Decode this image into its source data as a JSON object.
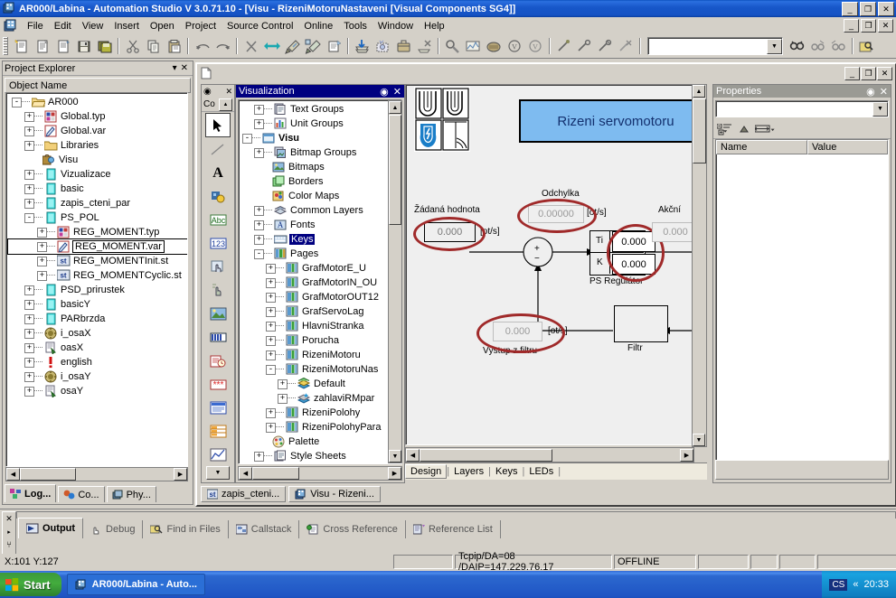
{
  "window": {
    "title": "AR000/Labina - Automation Studio V 3.0.71.10 - [Visu - RizeniMotoruNastaveni [Visual Components SG4]]",
    "minimize": "_",
    "maximize": "❐",
    "close": "✕",
    "icon": "automation-studio-icon"
  },
  "menu": {
    "items": [
      "File",
      "Edit",
      "View",
      "Insert",
      "Open",
      "Project",
      "Source Control",
      "Online",
      "Tools",
      "Window",
      "Help"
    ],
    "doc_icon": "document-icon"
  },
  "toolbar": {
    "combo_value": "",
    "groups": [
      {
        "name": "file",
        "buttons": [
          "new-project-icon",
          "open-project-icon",
          "save-as-icon",
          "save-icon",
          "save-all-icon"
        ]
      },
      {
        "name": "edit",
        "buttons": [
          "cut-icon",
          "copy-icon",
          "paste-icon"
        ]
      },
      {
        "name": "history",
        "buttons": [
          "undo-icon",
          "redo-icon"
        ]
      },
      {
        "name": "build",
        "buttons": [
          "stop-icon",
          "transfer-icon",
          "build-icon",
          "build-all-icon",
          "build-config-icon"
        ]
      },
      {
        "name": "download",
        "buttons": [
          "download-icon",
          "download-changes-icon",
          "project-install-icon",
          "remove-icon"
        ]
      },
      {
        "name": "monitor",
        "buttons": [
          "watch-icon",
          "trace-icon",
          "profiler-icon",
          "monitor-icon",
          "monitor-off-icon"
        ]
      },
      {
        "name": "debug",
        "buttons": [
          "breakpoint-icon",
          "step-icon",
          "step-over-icon",
          "clear-breakpoints-icon"
        ]
      },
      {
        "name": "find",
        "buttons": [
          "find-icon",
          "find-next-icon",
          "find-prev-icon",
          "find-in-files-icon"
        ]
      }
    ]
  },
  "project_explorer": {
    "title": "Project Explorer",
    "column_header": "Object Name",
    "auto_hide": "▾",
    "close": "✕",
    "tree": [
      {
        "label": "AR000",
        "depth": 0,
        "expander": "-",
        "icon": "folder-open-icon",
        "selected": false
      },
      {
        "label": "Global.typ",
        "depth": 1,
        "expander": "+",
        "icon": "typ-file-icon",
        "selected": false
      },
      {
        "label": "Global.var",
        "depth": 1,
        "expander": "+",
        "icon": "var-file-icon",
        "selected": false
      },
      {
        "label": "Libraries",
        "depth": 1,
        "expander": "+",
        "icon": "folder-icon",
        "selected": false
      },
      {
        "label": "Visu",
        "depth": 1,
        "expander": "",
        "icon": "visu-icon",
        "selected": false
      },
      {
        "label": "Vizualizace",
        "depth": 1,
        "expander": "+",
        "icon": "package-icon",
        "selected": false
      },
      {
        "label": "basic",
        "depth": 1,
        "expander": "+",
        "icon": "package-icon",
        "selected": false
      },
      {
        "label": "zapis_cteni_par",
        "depth": 1,
        "expander": "+",
        "icon": "package-icon",
        "selected": false
      },
      {
        "label": "PS_POL",
        "depth": 1,
        "expander": "-",
        "icon": "package-icon",
        "selected": false
      },
      {
        "label": "REG_MOMENT.typ",
        "depth": 2,
        "expander": "+",
        "icon": "typ-file-icon",
        "selected": false
      },
      {
        "label": "REG_MOMENT.var",
        "depth": 2,
        "expander": "+",
        "icon": "var-file-icon",
        "selected": true
      },
      {
        "label": "REG_MOMENTInit.st",
        "depth": 2,
        "expander": "+",
        "icon": "st-file-icon",
        "selected": false
      },
      {
        "label": "REG_MOMENTCyclic.st",
        "depth": 2,
        "expander": "+",
        "icon": "st-file-icon",
        "selected": false
      },
      {
        "label": "PSD_prirustek",
        "depth": 1,
        "expander": "+",
        "icon": "package-icon",
        "selected": false
      },
      {
        "label": "basicY",
        "depth": 1,
        "expander": "+",
        "icon": "package-icon",
        "selected": false
      },
      {
        "label": "PARbrzda",
        "depth": 1,
        "expander": "+",
        "icon": "package-icon",
        "selected": false
      },
      {
        "label": "i_osaX",
        "depth": 1,
        "expander": "+",
        "icon": "axis-icon",
        "selected": false
      },
      {
        "label": "oasX",
        "depth": 1,
        "expander": "+",
        "icon": "config-icon",
        "selected": false
      },
      {
        "label": "english",
        "depth": 1,
        "expander": "+",
        "icon": "alarm-icon",
        "selected": false
      },
      {
        "label": "i_osaY",
        "depth": 1,
        "expander": "+",
        "icon": "axis-icon",
        "selected": false
      },
      {
        "label": "osaY",
        "depth": 1,
        "expander": "+",
        "icon": "config-icon",
        "selected": false
      }
    ],
    "tabs": [
      {
        "label": "Log...",
        "icon": "logical-view-icon",
        "active": true
      },
      {
        "label": "Co...",
        "icon": "configuration-view-icon",
        "active": false
      },
      {
        "label": "Phy...",
        "icon": "physical-view-icon",
        "active": false
      }
    ]
  },
  "toolbox": {
    "header": "Co",
    "scroll_up": "▲",
    "scroll_down": "▼",
    "tools": [
      {
        "name": "pointer-tool",
        "selected": true
      },
      {
        "name": "line-tool",
        "selected": false
      },
      {
        "name": "text-tool",
        "selected": false
      },
      {
        "name": "bitmap-button-tool",
        "selected": false
      },
      {
        "name": "string-output-tool",
        "selected": false
      },
      {
        "name": "numeric-output-tool",
        "selected": false,
        "highlighted": true
      },
      {
        "name": "touch-area-tool",
        "selected": false,
        "highlighted": true
      },
      {
        "name": "hotspot-tool",
        "selected": false
      },
      {
        "name": "picture-tool",
        "selected": false
      },
      {
        "name": "bargraph-tool",
        "selected": false
      },
      {
        "name": "datetime-tool",
        "selected": false
      },
      {
        "name": "password-tool",
        "selected": false
      },
      {
        "name": "listbox-tool",
        "selected": false
      },
      {
        "name": "table-tool",
        "selected": false
      },
      {
        "name": "trend-tool",
        "selected": false
      }
    ]
  },
  "visualization_panel": {
    "title": "Visualization",
    "pin": "◉",
    "close": "✕",
    "tree": [
      {
        "label": "Text Groups",
        "depth": 1,
        "expander": "+",
        "icon": "text-groups-icon",
        "bold": false,
        "selected": false
      },
      {
        "label": "Unit Groups",
        "depth": 1,
        "expander": "+",
        "icon": "unit-groups-icon",
        "bold": false,
        "selected": false
      },
      {
        "label": "Visu",
        "depth": 0,
        "expander": "-",
        "icon": "visu-root-icon",
        "bold": true,
        "selected": false
      },
      {
        "label": "Bitmap Groups",
        "depth": 1,
        "expander": "+",
        "icon": "bitmap-groups-icon",
        "bold": false,
        "selected": false
      },
      {
        "label": "Bitmaps",
        "depth": 1,
        "expander": "",
        "icon": "bitmaps-icon",
        "bold": false,
        "selected": false
      },
      {
        "label": "Borders",
        "depth": 1,
        "expander": "",
        "icon": "borders-icon",
        "bold": false,
        "selected": false
      },
      {
        "label": "Color Maps",
        "depth": 1,
        "expander": "",
        "icon": "color-maps-icon",
        "bold": false,
        "selected": false
      },
      {
        "label": "Common Layers",
        "depth": 1,
        "expander": "+",
        "icon": "layers-icon",
        "bold": false,
        "selected": false
      },
      {
        "label": "Fonts",
        "depth": 1,
        "expander": "+",
        "icon": "fonts-icon",
        "bold": false,
        "selected": false
      },
      {
        "label": "Keys",
        "depth": 1,
        "expander": "+",
        "icon": "keys-icon",
        "bold": false,
        "selected": true
      },
      {
        "label": "Pages",
        "depth": 1,
        "expander": "-",
        "icon": "pages-icon",
        "bold": false,
        "selected": false
      },
      {
        "label": "GrafMotorE_U",
        "depth": 2,
        "expander": "+",
        "icon": "page-icon",
        "bold": false,
        "selected": false
      },
      {
        "label": "GrafMotorIN_OU",
        "depth": 2,
        "expander": "+",
        "icon": "page-icon",
        "bold": false,
        "selected": false
      },
      {
        "label": "GrafMotorOUT12",
        "depth": 2,
        "expander": "+",
        "icon": "page-icon",
        "bold": false,
        "selected": false
      },
      {
        "label": "GrafServoLag",
        "depth": 2,
        "expander": "+",
        "icon": "page-icon",
        "bold": false,
        "selected": false
      },
      {
        "label": "HlavniStranka",
        "depth": 2,
        "expander": "+",
        "icon": "page-icon",
        "bold": false,
        "selected": false
      },
      {
        "label": "Porucha",
        "depth": 2,
        "expander": "+",
        "icon": "page-icon",
        "bold": false,
        "selected": false
      },
      {
        "label": "RizeniMotoru",
        "depth": 2,
        "expander": "+",
        "icon": "page-icon",
        "bold": false,
        "selected": false
      },
      {
        "label": "RizeniMotoruNas",
        "depth": 2,
        "expander": "-",
        "icon": "page-icon",
        "bold": false,
        "selected": false
      },
      {
        "label": "Default",
        "depth": 3,
        "expander": "+",
        "icon": "layer-icon",
        "bold": false,
        "selected": false
      },
      {
        "label": "zahlaviRMpar",
        "depth": 3,
        "expander": "+",
        "icon": "layer-star-icon",
        "bold": false,
        "selected": false
      },
      {
        "label": "RizeniPolohy",
        "depth": 2,
        "expander": "+",
        "icon": "page-icon",
        "bold": false,
        "selected": false
      },
      {
        "label": "RizeniPolohyPara",
        "depth": 2,
        "expander": "+",
        "icon": "page-icon",
        "bold": false,
        "selected": false
      },
      {
        "label": "Palette",
        "depth": 1,
        "expander": "",
        "icon": "palette-icon",
        "bold": false,
        "selected": false
      },
      {
        "label": "Style Sheets",
        "depth": 1,
        "expander": "+",
        "icon": "stylesheets-icon",
        "bold": false,
        "selected": false
      }
    ]
  },
  "canvas": {
    "banner_title": "Rizeni servomotoru",
    "logo": "vut-fekt-logo",
    "labels": {
      "setpoint": "Žádaná hodnota",
      "setpoint_unit": "[ot/s]",
      "deviation": "Odchylka",
      "deviation_unit": "[ot/s]",
      "action": "Akční",
      "regulator": "PS Regulátor",
      "regulator_ti": "Ti",
      "regulator_k": "K",
      "filter": "Filtr",
      "filter_out": "Výstup z filtru",
      "filter_out_unit": "[ot/s]",
      "sum_plus": "+",
      "sum_minus": "−"
    },
    "values": {
      "setpoint": "0.000",
      "deviation": "0.00000",
      "regulator_ti": "0.000",
      "regulator_k": "0.000",
      "action": "0.000",
      "filter_out": "0.000"
    },
    "annotation_color": "#a02a2a",
    "tabs": [
      {
        "label": "Design",
        "active": true
      },
      {
        "label": "Layers",
        "active": false
      },
      {
        "label": "Keys",
        "active": false
      },
      {
        "label": "LEDs",
        "active": false
      }
    ]
  },
  "properties": {
    "title": "Properties",
    "pin": "◉",
    "close": "✕",
    "selector_value": "",
    "columns": [
      "Name",
      "Value"
    ],
    "rows": [],
    "toolbar_icons": [
      "categorized-icon",
      "alphabetic-icon",
      "property-pages-icon"
    ]
  },
  "document_tabs": [
    {
      "label": "zapis_cteni...",
      "icon": "st-file-icon",
      "active": false
    },
    {
      "label": "Visu - Rizeni...",
      "icon": "visu-icon",
      "active": true
    }
  ],
  "output_pane": {
    "tabs": [
      {
        "label": "Output",
        "icon": "output-icon",
        "active": true
      },
      {
        "label": "Debug",
        "icon": "debug-icon",
        "active": false
      },
      {
        "label": "Find in Files",
        "icon": "find-in-files-icon",
        "active": false
      },
      {
        "label": "Callstack",
        "icon": "callstack-icon",
        "active": false
      },
      {
        "label": "Cross Reference",
        "icon": "cross-reference-icon",
        "active": false
      },
      {
        "label": "Reference List",
        "icon": "reference-list-icon",
        "active": false
      }
    ],
    "close": "✕",
    "pin": "⑂"
  },
  "status_bar": {
    "coords": "X:101 Y:127",
    "blank1": "",
    "connection": "Tcpip/DA=08 /DAIP=147.229.76.17",
    "mode": "OFFLINE",
    "blank2": "",
    "blank3": "",
    "blank4": "",
    "blank5": ""
  },
  "taskbar": {
    "start": "Start",
    "items": [
      {
        "label": "AR000/Labina - Auto...",
        "icon": "automation-studio-icon"
      }
    ],
    "tray": {
      "lang": "CS",
      "chevron": "«",
      "clock": "20:33"
    }
  }
}
